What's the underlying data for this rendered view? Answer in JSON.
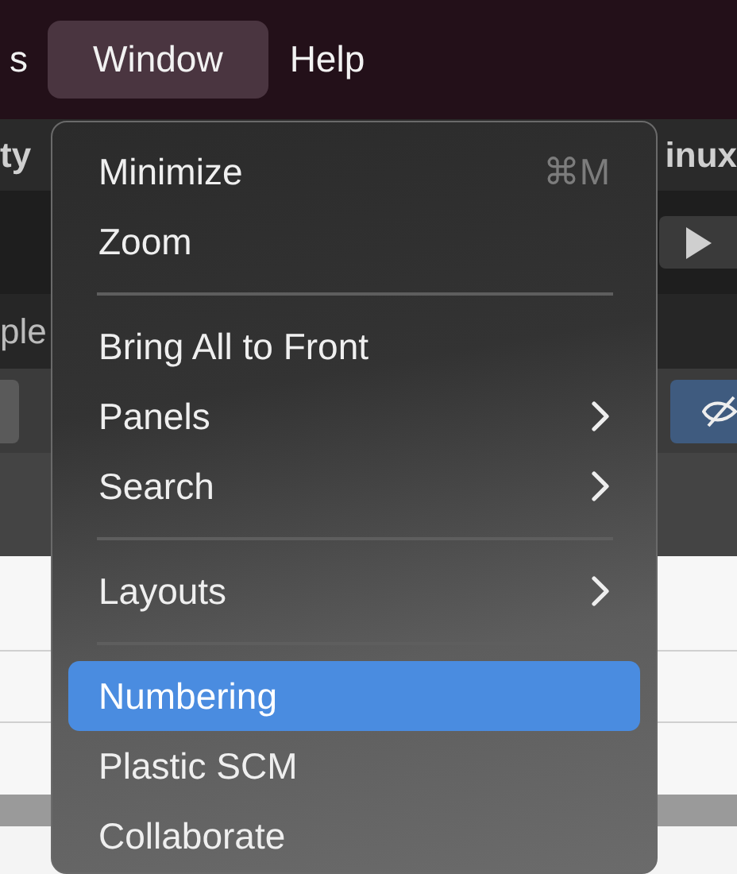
{
  "menu_bar": {
    "items": [
      {
        "label": "s",
        "selected": false
      },
      {
        "label": "Window",
        "selected": true
      },
      {
        "label": "Help",
        "selected": false
      }
    ]
  },
  "background_window": {
    "title_left": "ty",
    "title_right": "inux",
    "label": "ple"
  },
  "menu": {
    "items": [
      {
        "kind": "item",
        "label": "Minimize",
        "shortcut": "⌘M",
        "submenu": false,
        "selected": false
      },
      {
        "kind": "item",
        "label": "Zoom",
        "submenu": false,
        "selected": false
      },
      {
        "kind": "separator"
      },
      {
        "kind": "item",
        "label": "Bring All to Front",
        "submenu": false,
        "selected": false
      },
      {
        "kind": "item",
        "label": "Panels",
        "submenu": true,
        "selected": false
      },
      {
        "kind": "item",
        "label": "Search",
        "submenu": true,
        "selected": false
      },
      {
        "kind": "separator"
      },
      {
        "kind": "item",
        "label": "Layouts",
        "submenu": true,
        "selected": false
      },
      {
        "kind": "separator"
      },
      {
        "kind": "item",
        "label": "Numbering",
        "submenu": false,
        "selected": true
      },
      {
        "kind": "item",
        "label": "Plastic SCM",
        "submenu": false,
        "selected": false
      },
      {
        "kind": "item",
        "label": "Collaborate",
        "submenu": false,
        "selected": false
      }
    ]
  }
}
